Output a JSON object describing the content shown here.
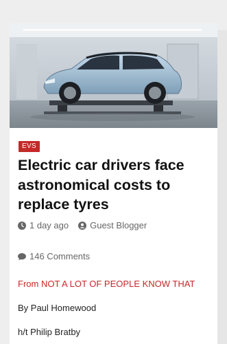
{
  "post": {
    "category": "EVS",
    "title": "Electric car drivers face astronomical costs to replace tyres",
    "date": "1 day ago",
    "author": "Guest Blogger",
    "comments": "146 Comments",
    "source_line": "From NOT A LOT OF PEOPLE KNOW THAT",
    "byline": "By Paul Homewood",
    "hat_tip": "h/t Philip Bratby"
  },
  "image": {
    "alt": "Electric car on a lift in a showroom"
  },
  "colors": {
    "accent": "#c62828",
    "meta": "#666666"
  },
  "icons": {
    "date": "clock-icon",
    "author": "user-icon",
    "comments": "comment-icon"
  }
}
